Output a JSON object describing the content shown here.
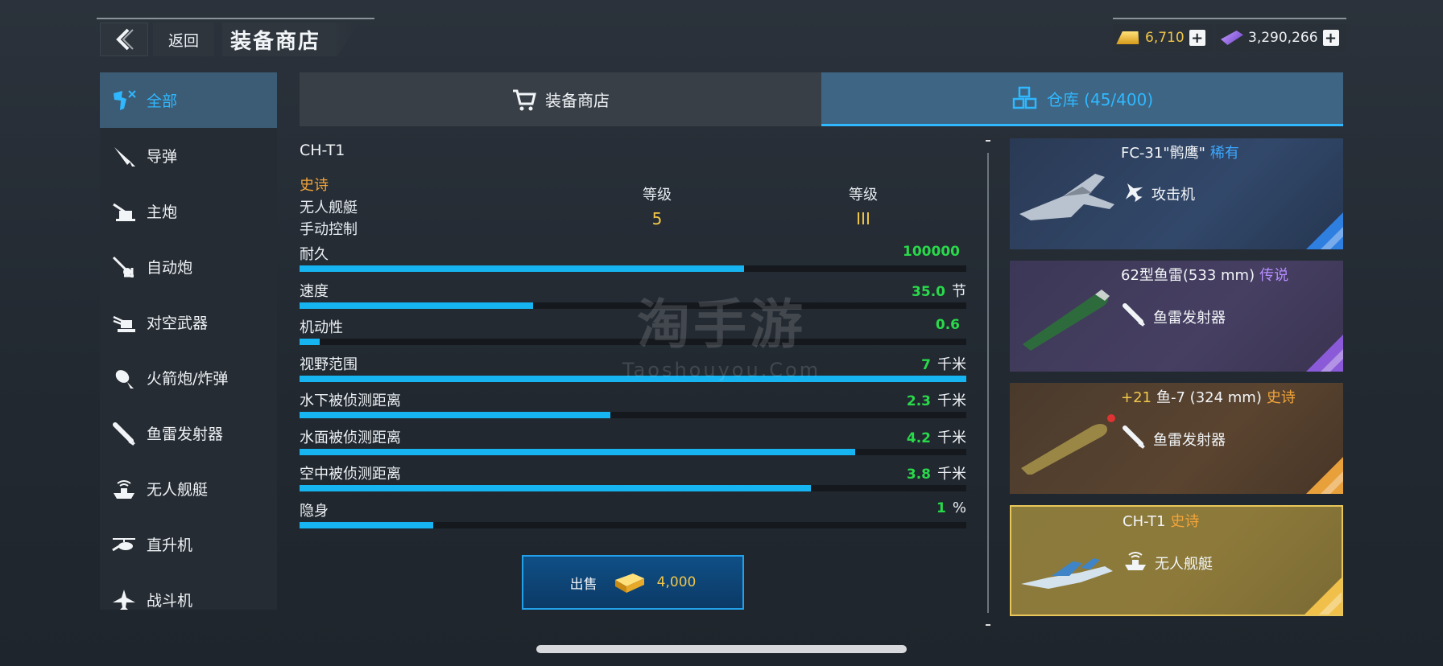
{
  "header": {
    "back_label": "返回",
    "title": "装备商店"
  },
  "currency": {
    "gold": "6,710",
    "gems": "3,290,266"
  },
  "sidebar": {
    "items": [
      {
        "label": "全部",
        "icon": "all-weapons-icon"
      },
      {
        "label": "导弹",
        "icon": "missile-icon"
      },
      {
        "label": "主炮",
        "icon": "main-gun-icon"
      },
      {
        "label": "自动炮",
        "icon": "autocannon-icon"
      },
      {
        "label": "对空武器",
        "icon": "anti-air-icon"
      },
      {
        "label": "火箭炮/炸弹",
        "icon": "rocket-bomb-icon"
      },
      {
        "label": "鱼雷发射器",
        "icon": "torpedo-launcher-icon"
      },
      {
        "label": "无人舰艇",
        "icon": "drone-boat-icon"
      },
      {
        "label": "直升机",
        "icon": "helicopter-icon"
      },
      {
        "label": "战斗机",
        "icon": "fighter-jet-icon"
      }
    ]
  },
  "tabs": {
    "shop": "装备商店",
    "warehouse": "仓库 (45/400)"
  },
  "detail": {
    "name": "CH-T1",
    "rarity": "史诗",
    "type": "无人舰艇",
    "control": "手动控制",
    "level_label": "等级",
    "level_value": "5",
    "tier_label": "等级",
    "tier_value": "III",
    "stats": [
      {
        "name": "耐久",
        "value": "100000",
        "unit": "",
        "fill": 0.667
      },
      {
        "name": "速度",
        "value": "35.0",
        "unit": "节",
        "fill": 0.35
      },
      {
        "name": "机动性",
        "value": "0.6",
        "unit": "",
        "fill": 0.03
      },
      {
        "name": "视野范围",
        "value": "7",
        "unit": "千米",
        "fill": 1.0
      },
      {
        "name": "水下被侦测距离",
        "value": "2.3",
        "unit": "千米",
        "fill": 0.466
      },
      {
        "name": "水面被侦测距离",
        "value": "4.2",
        "unit": "千米",
        "fill": 0.833
      },
      {
        "name": "空中被侦测距离",
        "value": "3.8",
        "unit": "千米",
        "fill": 0.767
      },
      {
        "name": "隐身",
        "value": "1",
        "unit": "%",
        "fill": 0.2
      }
    ],
    "sell_label": "出售",
    "sell_price": "4,000"
  },
  "inventory": [
    {
      "title": "FC-31\"鹘鹰\"",
      "rarity": "稀有",
      "rarity_color": "#3ba8ff",
      "class": "攻击机",
      "class_icon": "attack-aircraft-icon",
      "plus": ""
    },
    {
      "title": "62型鱼雷(533 mm)",
      "rarity": "传说",
      "rarity_color": "#b58cff",
      "class": "鱼雷发射器",
      "class_icon": "torpedo-launcher-icon",
      "plus": ""
    },
    {
      "title": "鱼-7 (324 mm)",
      "rarity": "史诗",
      "rarity_color": "#f2a43a",
      "class": "鱼雷发射器",
      "class_icon": "torpedo-launcher-icon",
      "plus": "+21"
    },
    {
      "title": "CH-T1",
      "rarity": "史诗",
      "rarity_color": "#f2a43a",
      "class": "无人舰艇",
      "class_icon": "drone-boat-icon",
      "plus": ""
    }
  ],
  "watermark": {
    "cn": "淘手游",
    "en": "Taoshouyou.Com"
  }
}
